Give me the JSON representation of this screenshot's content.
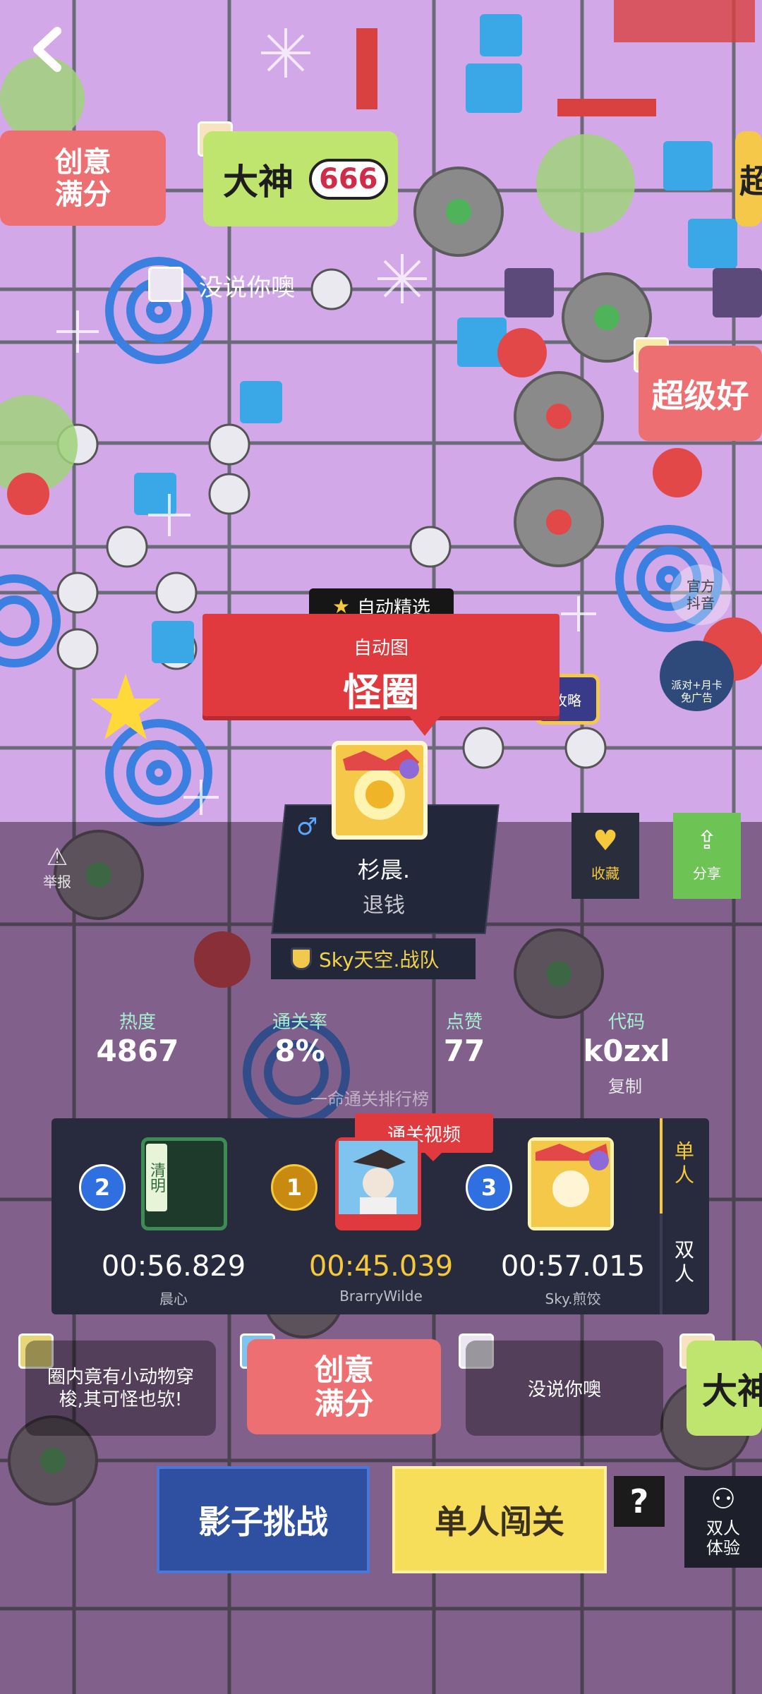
{
  "nav": {
    "back_icon": "chevron-left-icon"
  },
  "level_bubbles": {
    "creative_full": "创意\n满分",
    "great_god": "大神",
    "great_god_number": "666",
    "no_say": "没说你噢",
    "super_good": "超级好",
    "super_partial": "超"
  },
  "side_links": {
    "official_douyin": "官方\n抖音",
    "ad_badge": "派对+月卡\n免广告",
    "strategy": "攻略"
  },
  "level": {
    "auto_tag": "自动精选",
    "subtitle": "自动图",
    "name": "怪圈"
  },
  "author": {
    "gender_icon": "male-icon",
    "name": "杉晨.",
    "subtitle": "退钱",
    "team": "Sky天空.战队"
  },
  "actions": {
    "favorite": "收藏",
    "share": "分享",
    "report": "举报"
  },
  "stats": [
    {
      "label": "热度",
      "value": "4867"
    },
    {
      "label": "通关率",
      "value": "8%"
    },
    {
      "label": "点赞",
      "value": "77"
    },
    {
      "label": "代码",
      "value": "k0zxl"
    }
  ],
  "copy_label": "复制",
  "leaderboard": {
    "title": "一命通关排行榜",
    "video_tag": "通关视频",
    "tabs": [
      "单人",
      "双人"
    ],
    "entries": [
      {
        "rank": "2",
        "time": "00:56.829",
        "name": "晨心",
        "avatar_text": "清明"
      },
      {
        "rank": "1",
        "time": "00:45.039",
        "name": "BrarryWilde"
      },
      {
        "rank": "3",
        "time": "00:57.015",
        "name": "Sky.煎饺"
      }
    ]
  },
  "comments": [
    {
      "text": "圈内竟有小动物穿梭,其可怪也欤!"
    },
    {
      "text": "创意\n满分"
    },
    {
      "text": "没说你噢"
    },
    {
      "text": "大神"
    }
  ],
  "buttons": {
    "shadow": "影子挑战",
    "single": "单人闯关",
    "help": "?",
    "duo": "双人\n体验"
  },
  "colors": {
    "accent_red": "#e03a3f",
    "gold": "#f5c93b",
    "panel": "#282b3e",
    "green": "#6dc455"
  }
}
